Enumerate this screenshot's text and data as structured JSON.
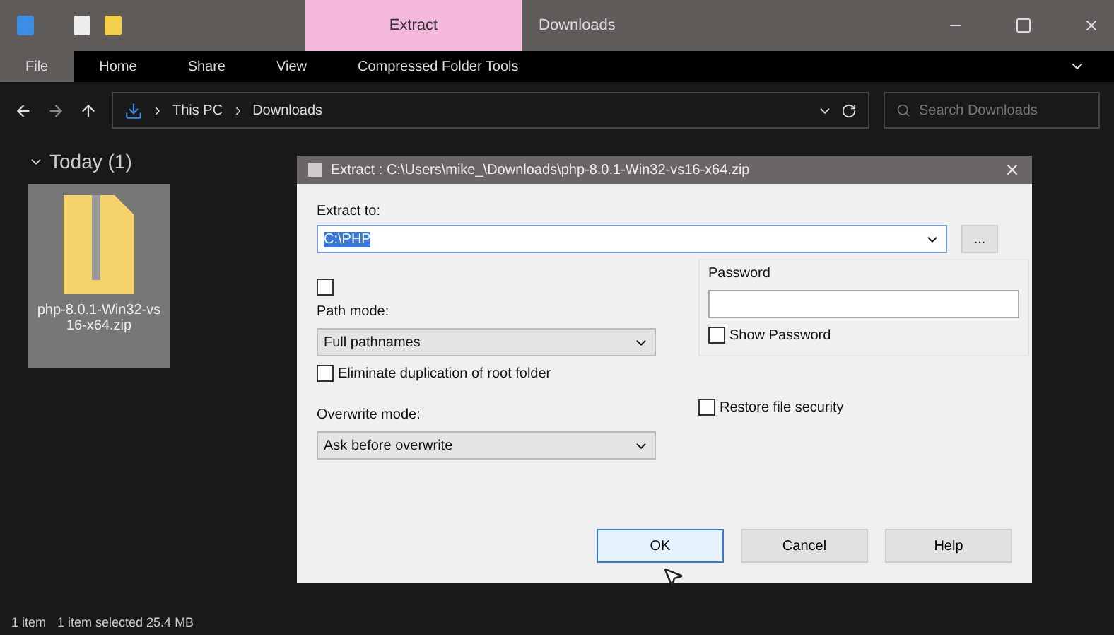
{
  "window": {
    "title": "Downloads",
    "context_tab": "Extract"
  },
  "ribbon_tabs": [
    {
      "label": "File",
      "selected": true
    },
    {
      "label": "Home",
      "selected": false
    },
    {
      "label": "Share",
      "selected": false
    },
    {
      "label": "View",
      "selected": false
    },
    {
      "label": "Compressed Folder Tools",
      "selected": false
    }
  ],
  "breadcrumb": [
    "This PC",
    "Downloads"
  ],
  "search": {
    "placeholder": "Search Downloads"
  },
  "group": {
    "label": "Today (1)",
    "expanded": true
  },
  "files": [
    {
      "name": "php-8.0.1-Win32-vs16-x64.zip",
      "selected": true
    }
  ],
  "status_bar": [
    "1 item",
    "1 item selected  25.4 MB"
  ],
  "dialog": {
    "title": "Extract : C:\\Users\\mike_\\Downloads\\php-8.0.1-Win32-vs16-x64.zip",
    "extract_to": {
      "label": "Extract to:",
      "value": "C:\\PHP"
    },
    "browse": "...",
    "unlabeled_checkbox": {
      "checked": false
    },
    "path_mode": {
      "label": "Path mode:",
      "value": "Full pathnames"
    },
    "eliminate": {
      "label": "Eliminate duplication of root folder",
      "checked": false
    },
    "overwrite_mode": {
      "label": "Overwrite mode:",
      "value": "Ask before overwrite"
    },
    "password": {
      "label": "Password"
    },
    "show_password": {
      "label": "Show Password",
      "checked": false
    },
    "restore_security": {
      "label": "Restore file security",
      "checked": false
    },
    "buttons": [
      {
        "label": "OK",
        "selected": true
      },
      {
        "label": "Cancel",
        "selected": false
      },
      {
        "label": "Help",
        "selected": false
      }
    ]
  }
}
